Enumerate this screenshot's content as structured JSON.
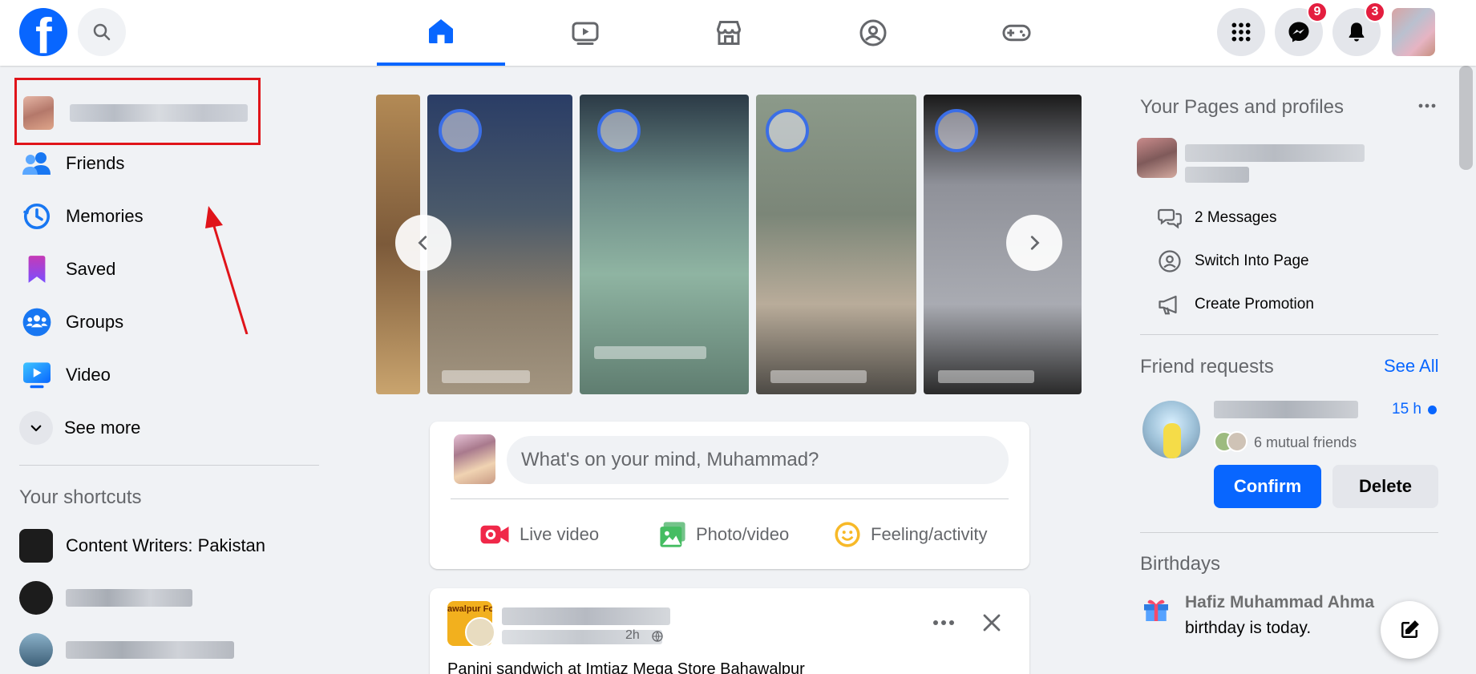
{
  "header": {
    "logo_letter": "f",
    "nav_tabs": [
      "home-icon",
      "video-icon",
      "marketplace-icon",
      "groups-icon",
      "gaming-icon"
    ],
    "messenger_badge": "9",
    "notifications_badge": "3",
    "brand_color": "#0866ff",
    "badge_color": "#e41e3f"
  },
  "sidebar": {
    "items": [
      {
        "label": "Friends"
      },
      {
        "label": "Memories"
      },
      {
        "label": "Saved"
      },
      {
        "label": "Groups"
      },
      {
        "label": "Video"
      },
      {
        "label": "See more"
      }
    ],
    "shortcuts_title": "Your shortcuts",
    "shortcuts": [
      {
        "label": "Content Writers: Pakistan"
      }
    ]
  },
  "composer": {
    "placeholder": "What's on your mind, Muhammad?",
    "actions": [
      {
        "label": "Live video"
      },
      {
        "label": "Photo/video"
      },
      {
        "label": "Feeling/activity"
      }
    ]
  },
  "post": {
    "avatar_text": "awalpur Food",
    "time": "2h",
    "text": "Panini sandwich at Imtiaz Mega Store Bahawalpur"
  },
  "right": {
    "pages_title": "Your Pages and profiles",
    "page_actions": [
      {
        "label": "2 Messages"
      },
      {
        "label": "Switch Into Page"
      },
      {
        "label": "Create Promotion"
      }
    ],
    "friend_requests_title": "Friend requests",
    "see_all": "See All",
    "request_time": "15 h",
    "mutual_friends": "6 mutual friends",
    "confirm": "Confirm",
    "delete": "Delete",
    "birthdays_title": "Birthdays",
    "birthday_name": "Hafiz Muhammad Ahma",
    "birthday_text": "birthday is today."
  }
}
